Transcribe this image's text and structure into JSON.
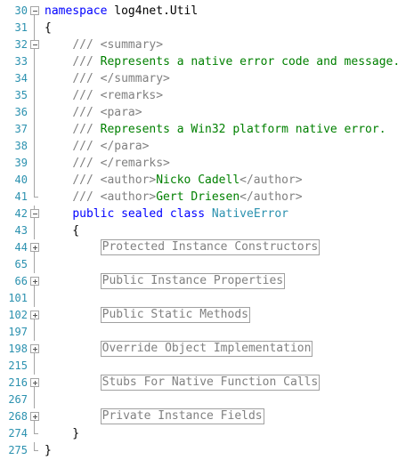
{
  "editor": {
    "lines": [
      {
        "num": "30",
        "fold": "minus",
        "parts": [
          {
            "t": "namespace",
            "c": "kw"
          },
          {
            "t": " log4net.Util",
            "c": "txt"
          }
        ]
      },
      {
        "num": "31",
        "fold": "line",
        "parts": [
          {
            "t": "{",
            "c": "txt"
          }
        ]
      },
      {
        "num": "32",
        "fold": "minus",
        "parts": [
          {
            "t": "    ",
            "c": "txt"
          },
          {
            "t": "/// <summary>",
            "c": "doc"
          }
        ]
      },
      {
        "num": "33",
        "fold": "line",
        "parts": [
          {
            "t": "    ",
            "c": "txt"
          },
          {
            "t": "///",
            "c": "doc"
          },
          {
            "t": " Represents a native error code and message.",
            "c": "cm"
          }
        ]
      },
      {
        "num": "34",
        "fold": "line",
        "parts": [
          {
            "t": "    ",
            "c": "txt"
          },
          {
            "t": "/// </summary>",
            "c": "doc"
          }
        ]
      },
      {
        "num": "35",
        "fold": "line",
        "parts": [
          {
            "t": "    ",
            "c": "txt"
          },
          {
            "t": "/// <remarks>",
            "c": "doc"
          }
        ]
      },
      {
        "num": "36",
        "fold": "line",
        "parts": [
          {
            "t": "    ",
            "c": "txt"
          },
          {
            "t": "/// <para>",
            "c": "doc"
          }
        ]
      },
      {
        "num": "37",
        "fold": "line",
        "parts": [
          {
            "t": "    ",
            "c": "txt"
          },
          {
            "t": "///",
            "c": "doc"
          },
          {
            "t": " Represents a Win32 platform native error.",
            "c": "cm"
          }
        ]
      },
      {
        "num": "38",
        "fold": "line",
        "parts": [
          {
            "t": "    ",
            "c": "txt"
          },
          {
            "t": "/// </para>",
            "c": "doc"
          }
        ]
      },
      {
        "num": "39",
        "fold": "line",
        "parts": [
          {
            "t": "    ",
            "c": "txt"
          },
          {
            "t": "/// </remarks>",
            "c": "doc"
          }
        ]
      },
      {
        "num": "40",
        "fold": "line",
        "parts": [
          {
            "t": "    ",
            "c": "txt"
          },
          {
            "t": "/// <author>",
            "c": "doc"
          },
          {
            "t": "Nicko Cadell",
            "c": "cm"
          },
          {
            "t": "</author>",
            "c": "doc"
          }
        ]
      },
      {
        "num": "41",
        "fold": "end",
        "parts": [
          {
            "t": "    ",
            "c": "txt"
          },
          {
            "t": "/// <author>",
            "c": "doc"
          },
          {
            "t": "Gert Driesen",
            "c": "cm"
          },
          {
            "t": "</author>",
            "c": "doc"
          }
        ]
      },
      {
        "num": "42",
        "fold": "minus",
        "parts": [
          {
            "t": "    ",
            "c": "txt"
          },
          {
            "t": "public",
            "c": "kw"
          },
          {
            "t": " ",
            "c": "txt"
          },
          {
            "t": "sealed",
            "c": "kw"
          },
          {
            "t": " ",
            "c": "txt"
          },
          {
            "t": "class",
            "c": "kw"
          },
          {
            "t": " ",
            "c": "txt"
          },
          {
            "t": "NativeError",
            "c": "ty"
          }
        ]
      },
      {
        "num": "43",
        "fold": "line",
        "parts": [
          {
            "t": "    {",
            "c": "txt"
          }
        ]
      },
      {
        "num": "44",
        "fold": "plus",
        "parts": [
          {
            "t": "        ",
            "c": "txt"
          },
          {
            "t": "Protected Instance Constructors",
            "c": "region"
          }
        ]
      },
      {
        "num": "65",
        "fold": "line",
        "parts": []
      },
      {
        "num": "66",
        "fold": "plus",
        "parts": [
          {
            "t": "        ",
            "c": "txt"
          },
          {
            "t": "Public Instance Properties",
            "c": "region"
          }
        ]
      },
      {
        "num": "101",
        "fold": "line",
        "parts": []
      },
      {
        "num": "102",
        "fold": "plus",
        "parts": [
          {
            "t": "        ",
            "c": "txt"
          },
          {
            "t": "Public Static Methods",
            "c": "region"
          }
        ]
      },
      {
        "num": "197",
        "fold": "line",
        "parts": []
      },
      {
        "num": "198",
        "fold": "plus",
        "parts": [
          {
            "t": "        ",
            "c": "txt"
          },
          {
            "t": "Override Object Implementation",
            "c": "region"
          }
        ]
      },
      {
        "num": "215",
        "fold": "line",
        "parts": []
      },
      {
        "num": "216",
        "fold": "plus",
        "parts": [
          {
            "t": "        ",
            "c": "txt"
          },
          {
            "t": "Stubs For Native Function Calls",
            "c": "region"
          }
        ]
      },
      {
        "num": "267",
        "fold": "line",
        "parts": []
      },
      {
        "num": "268",
        "fold": "plus",
        "parts": [
          {
            "t": "        ",
            "c": "txt"
          },
          {
            "t": "Private Instance Fields",
            "c": "region"
          }
        ]
      },
      {
        "num": "274",
        "fold": "end",
        "parts": [
          {
            "t": "    }",
            "c": "txt"
          }
        ]
      },
      {
        "num": "275",
        "fold": "end",
        "parts": [
          {
            "t": "}",
            "c": "txt"
          }
        ]
      }
    ]
  },
  "colors": {
    "keyword": "#0000ff",
    "comment": "#008000",
    "doc_tag": "#808080",
    "type": "#2b91af",
    "line_number": "#2b91af",
    "region_border": "#a0a0a0"
  }
}
